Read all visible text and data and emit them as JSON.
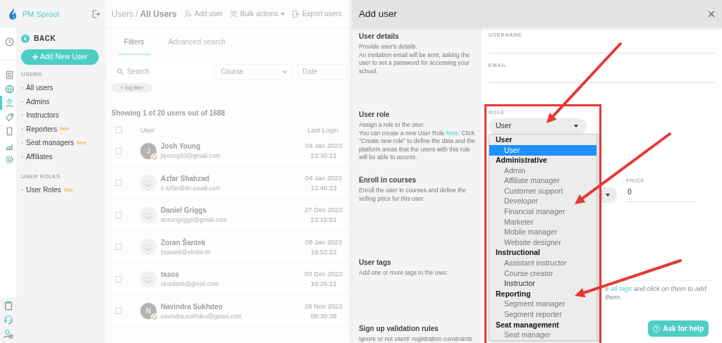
{
  "sidebar": {
    "brand": "PM Sprout",
    "back_label": "BACK",
    "add_button": "Add New User",
    "rail_items": [
      {
        "kind": "clock",
        "selected": false
      },
      {
        "kind": "calculator",
        "selected": false
      },
      {
        "kind": "globe",
        "selected": false
      },
      {
        "kind": "user",
        "selected": true
      },
      {
        "kind": "tag",
        "selected": false
      },
      {
        "kind": "mobile",
        "selected": false
      },
      {
        "kind": "chart",
        "selected": false
      },
      {
        "kind": "gear",
        "selected": false
      }
    ],
    "rail_bottom": [
      {
        "kind": "clipboard"
      },
      {
        "kind": "headset"
      },
      {
        "kind": "user-star"
      }
    ],
    "sections": [
      {
        "title": "USERS",
        "items": [
          {
            "label": "All users"
          },
          {
            "label": "Admins"
          },
          {
            "label": "Instructors"
          },
          {
            "label": "Reporters",
            "badge": "New"
          },
          {
            "label": "Seat managers",
            "badge": "New"
          },
          {
            "label": "Affiliates"
          }
        ]
      },
      {
        "title": "USER ROLES",
        "items": [
          {
            "label": "User Roles",
            "badge": "New"
          }
        ]
      }
    ]
  },
  "background_page": {
    "breadcrumb": {
      "parent": "Users",
      "separator": "/",
      "current": "All Users"
    },
    "actions": [
      {
        "kind": "add",
        "label": "Add user"
      },
      {
        "kind": "bulk",
        "label": "Bulk actions"
      },
      {
        "kind": "export",
        "label": "Export users"
      }
    ],
    "tabs": [
      {
        "label": "Filters",
        "selected": true
      },
      {
        "label": "Advanced search",
        "selected": false
      }
    ],
    "filters": {
      "search_placeholder": "Search",
      "course_placeholder": "Course",
      "date_placeholder": "Date",
      "tag_filter": "+ tag filter"
    },
    "summary": "Showing 1 of 20 users out of 1688",
    "table": {
      "columns": [
        "User",
        "Last Login"
      ],
      "select_all_checked": false,
      "rows": [
        {
          "name": "Josh Young",
          "email": "jtyoung93@gmail.com",
          "date": "04 Jan 2023",
          "time": "23:30:21",
          "checked": false,
          "avatar": {
            "kind": "initial",
            "letter": "J"
          }
        },
        {
          "name": "Azfar Shahzad",
          "email": "s.azfar@ttc-saudi.com",
          "date": "04 Jan 2023",
          "time": "13:46:23",
          "checked": false,
          "avatar": {
            "kind": "smiley"
          }
        },
        {
          "name": "Daniel Griggs",
          "email": "ansongriggs@gmail.com",
          "date": "27 Dec 2022",
          "time": "23:15:51",
          "checked": false,
          "avatar": {
            "kind": "smiley"
          }
        },
        {
          "name": "Zoran Šantek",
          "email": "zsantek@ekobit.hr",
          "date": "08 Jan 2023",
          "time": "19:53:22",
          "checked": false,
          "avatar": {
            "kind": "smiley"
          }
        },
        {
          "name": "tasos",
          "email": "skordaris@gmail.com",
          "date": "03 Dec 2022",
          "time": "10:26:21",
          "checked": false,
          "avatar": {
            "kind": "smiley"
          }
        },
        {
          "name": "Navindra Sukhdeo",
          "email": "navindra.sukhdeo@gmail.com",
          "date": "26 Nov 2022",
          "time": "06:30:38",
          "checked": false,
          "avatar": {
            "kind": "initial",
            "letter": "N"
          }
        }
      ]
    }
  },
  "modal": {
    "title": "Add user",
    "user_details": {
      "title": "User details",
      "description": [
        "Provide user's details.",
        "An invitation email will be sent, asking the user to set a password for accessing your school."
      ],
      "fields": [
        {
          "label": "USERNAME"
        },
        {
          "label": "EMAIL"
        }
      ]
    },
    "user_role": {
      "title": "User role",
      "intro": "Assign a role to the user.",
      "before_link": "You can create a new User Role ",
      "link": "here",
      "after_link": ". Click \"Create new role\" to define the data and the platform areas that the users with this role will be able to access."
    },
    "role_field": {
      "label": "ROLE",
      "value": "User",
      "groups": [
        {
          "label": "User",
          "options": [
            {
              "label": "User",
              "selected": true,
              "hovered": false
            }
          ]
        },
        {
          "label": "Administrative",
          "options": [
            {
              "label": "Admin",
              "selected": false,
              "hovered": false
            },
            {
              "label": "Affiliate manager",
              "selected": false,
              "hovered": false
            },
            {
              "label": "Customer support",
              "selected": false,
              "hovered": false
            },
            {
              "label": "Developer",
              "selected": false,
              "hovered": false
            },
            {
              "label": "Financial manager",
              "selected": false,
              "hovered": false
            },
            {
              "label": "Marketer",
              "selected": false,
              "hovered": false
            },
            {
              "label": "Mobile manager",
              "selected": false,
              "hovered": false
            },
            {
              "label": "Website designer",
              "selected": false,
              "hovered": false
            }
          ]
        },
        {
          "label": "Instructional",
          "options": [
            {
              "label": "Assistant instructor",
              "selected": false,
              "hovered": false
            },
            {
              "label": "Course creator",
              "selected": false,
              "hovered": false
            },
            {
              "label": "Instructor",
              "selected": false,
              "hovered": true
            }
          ]
        },
        {
          "label": "Reporting",
          "options": [
            {
              "label": "Segment manager",
              "selected": false,
              "hovered": false
            },
            {
              "label": "Segment reporter",
              "selected": false,
              "hovered": false
            }
          ]
        },
        {
          "label": "Seat management",
          "options": [
            {
              "label": "Seat manager",
              "selected": false,
              "hovered": false
            }
          ]
        }
      ]
    },
    "enroll": {
      "title": "Enroll in courses",
      "description": "Enroll the user in courses and define the selling price for this user.",
      "price_label": "PRICE",
      "price_value": "0"
    },
    "user_tags": {
      "title": "User tags",
      "description": "Add one or more tags to the user.",
      "hint_before": "e ",
      "hint_link": "all tags",
      "hint_after": " and click on them to add them."
    },
    "validation": {
      "title": "Sign up validation rules",
      "description": "Ignore or not users' registration constraints"
    },
    "help_button": "Ask for help"
  }
}
